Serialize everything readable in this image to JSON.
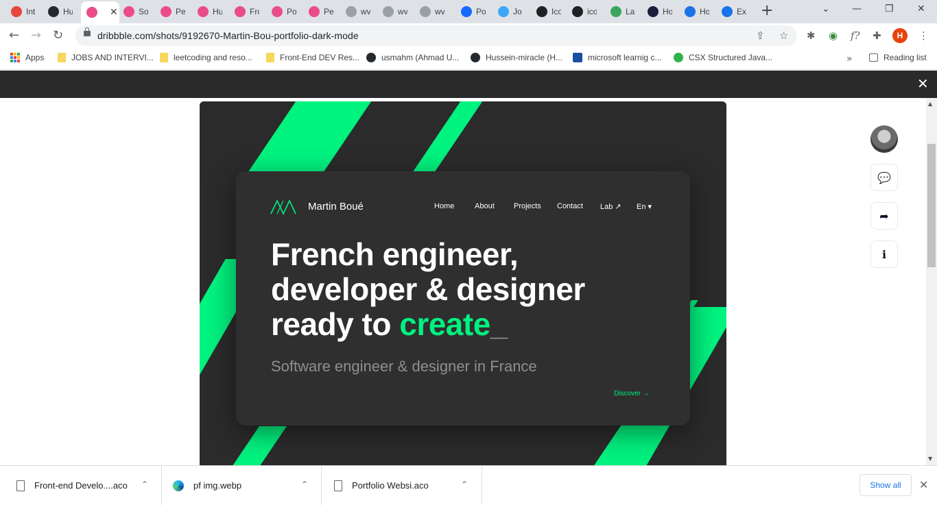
{
  "browser": {
    "tabs": [
      {
        "label": "Int",
        "icon": "gauge-icon",
        "color": "#e8453c"
      },
      {
        "label": "Hu",
        "icon": "github-icon",
        "color": "#24292e"
      },
      {
        "label": "",
        "icon": "dribbble-icon",
        "color": "#ea4c89",
        "active": true
      },
      {
        "label": "So",
        "icon": "dribbble-icon",
        "color": "#ea4c89"
      },
      {
        "label": "Pe",
        "icon": "dribbble-icon",
        "color": "#ea4c89"
      },
      {
        "label": "Hu",
        "icon": "dribbble-icon",
        "color": "#ea4c89"
      },
      {
        "label": "Fro",
        "icon": "dribbble-icon",
        "color": "#ea4c89"
      },
      {
        "label": "Po",
        "icon": "dribbble-icon",
        "color": "#ea4c89"
      },
      {
        "label": "Pe",
        "icon": "dribbble-icon",
        "color": "#ea4c89"
      },
      {
        "label": "wv",
        "icon": "behance-icon",
        "color": "#9aa0a6"
      },
      {
        "label": "wv",
        "icon": "behance-icon",
        "color": "#9aa0a6"
      },
      {
        "label": "wv",
        "icon": "behance-icon",
        "color": "#9aa0a6"
      },
      {
        "label": "Po",
        "icon": "behance-icon",
        "color": "#1769ff"
      },
      {
        "label": "Jo",
        "icon": "diamond-icon",
        "color": "#3aa9f5"
      },
      {
        "label": "Ico",
        "icon": "icon-icon",
        "color": "#202124"
      },
      {
        "label": "ico",
        "icon": "icon-icon",
        "color": "#202124"
      },
      {
        "label": "La",
        "icon": "globe-icon",
        "color": "#3ba55d"
      },
      {
        "label": "Ho",
        "icon": "a-icon",
        "color": "#1b1f3b"
      },
      {
        "label": "Ho",
        "icon": "loading-icon",
        "color": "#1a73e8"
      },
      {
        "label": "Ext",
        "icon": "puzzle-icon",
        "color": "#1a73e8"
      }
    ],
    "new_tab_symbol": "+",
    "window_controls": {
      "tab_search": "⌄",
      "minimize": "—",
      "maximize": "❐",
      "close": "✕"
    },
    "nav": {
      "back": "←",
      "forward": "→",
      "reload": "↻"
    },
    "url": "dribbble.com/shots/9192670-Martin-Bou-portfolio-dark-mode",
    "omnibox_icons": {
      "share": "⇪",
      "star": "☆"
    },
    "extensions": {
      "bug": "✱",
      "globe": "◉",
      "fx": "f?",
      "puzzle": "✚",
      "menu": "⋮"
    },
    "profile_initial": "H",
    "bookmarks": [
      {
        "label": "Apps",
        "type": "apps"
      },
      {
        "label": "JOBS AND INTERVI...",
        "type": "folder"
      },
      {
        "label": "leetcoding and reso...",
        "type": "folder"
      },
      {
        "label": "Front-End DEV Res...",
        "type": "folder"
      },
      {
        "label": "usmahm (Ahmad U...",
        "type": "github"
      },
      {
        "label": "Hussein-miracle (H...",
        "type": "github"
      },
      {
        "label": "microsoft learnig c...",
        "type": "ms"
      },
      {
        "label": "CSX Structured Java...",
        "type": "csx"
      }
    ],
    "bookmarks_more": "»",
    "reading_list": "Reading list"
  },
  "page": {
    "overlay_close": "✕",
    "shot": {
      "brand": "Martin Boué",
      "nav": [
        "Home",
        "About",
        "Projects",
        "Contact",
        "Lab ↗",
        "En ▾"
      ],
      "hero_line1": "French engineer,",
      "hero_line2": "developer & designer",
      "hero_line3_prefix": "ready to ",
      "hero_line3_accent": "create",
      "hero_cursor": "_",
      "subtitle": "Software engineer & designer in France",
      "discover": "Discover →",
      "accent_color": "#00f27f"
    },
    "side_actions": {
      "comment": "💬",
      "share": "➦",
      "info": "ℹ"
    }
  },
  "downloads": {
    "items": [
      {
        "name": "Front-end Develo....aco",
        "icon": "file-icon"
      },
      {
        "name": "pf img.webp",
        "icon": "edge-icon"
      },
      {
        "name": "Portfolio Websi.aco",
        "icon": "file-icon"
      }
    ],
    "chevron": "⌃",
    "show_all": "Show all",
    "close": "✕"
  }
}
